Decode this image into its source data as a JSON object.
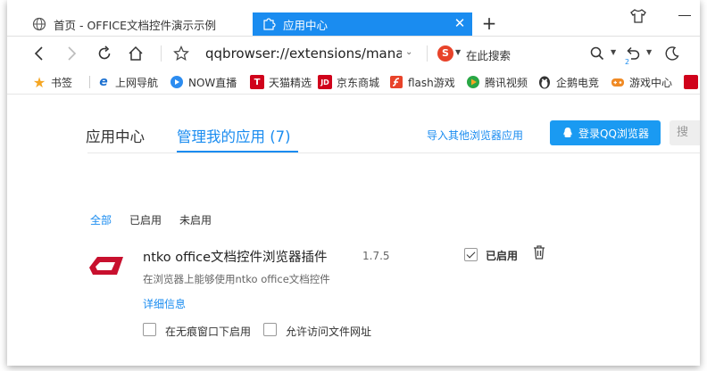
{
  "tabs": [
    {
      "label": "首页 - OFFICE文档控件演示示例",
      "icon": "globe-icon",
      "active": false
    },
    {
      "label": "应用中心",
      "icon": "puzzle-icon",
      "active": true
    }
  ],
  "address_bar": {
    "url": "qqbrowser://extensions/manag",
    "search_placeholder": "在此搜索",
    "badge": "2"
  },
  "bookmarks": [
    {
      "label": "书签",
      "icon": "star-icon",
      "color": "#f5a623"
    },
    {
      "label": "上网导航",
      "icon": "ie-icon",
      "color": "#1a6fd0"
    },
    {
      "label": "NOW直播",
      "icon": "now-icon",
      "color": "#2c8cf0"
    },
    {
      "label": "天猫精选",
      "icon": "tmall-icon",
      "color": "#d0021b"
    },
    {
      "label": "京东商城",
      "icon": "jd-icon",
      "color": "#d0021b"
    },
    {
      "label": "flash游戏",
      "icon": "flash-icon",
      "color": "#e8432a"
    },
    {
      "label": "腾讯视频",
      "icon": "video-icon",
      "color": "#29a745"
    },
    {
      "label": "企鹅电竞",
      "icon": "penguin-icon",
      "color": "#333333"
    },
    {
      "label": "游戏中心",
      "icon": "game-icon",
      "color": "#f08a24"
    }
  ],
  "bookmark_logo_initials": {
    "ie": "e",
    "tmall": "T",
    "jd": "JD"
  },
  "page": {
    "tab_app_center": "应用中心",
    "tab_manage": "管理我的应用 (7)",
    "import_link": "导入其他浏览器应用",
    "login_button": "登录QQ浏览器",
    "search_button": "搜"
  },
  "filters": {
    "all": "全部",
    "enabled": "已启用",
    "disabled": "未启用"
  },
  "extension": {
    "name": "ntko office文档控件浏览器插件",
    "version": "1.7.5",
    "description": "在浏览器上能够使用ntko office文档控件",
    "details_link": "详细信息",
    "enabled_label": "已启用",
    "enabled": true,
    "incognito_label": "在无痕窗口下启用",
    "incognito": false,
    "file_url_label": "允许访问文件网址",
    "file_url": false
  },
  "colors": {
    "accent": "#1a8cf0",
    "logo_red": "#c8102e"
  }
}
